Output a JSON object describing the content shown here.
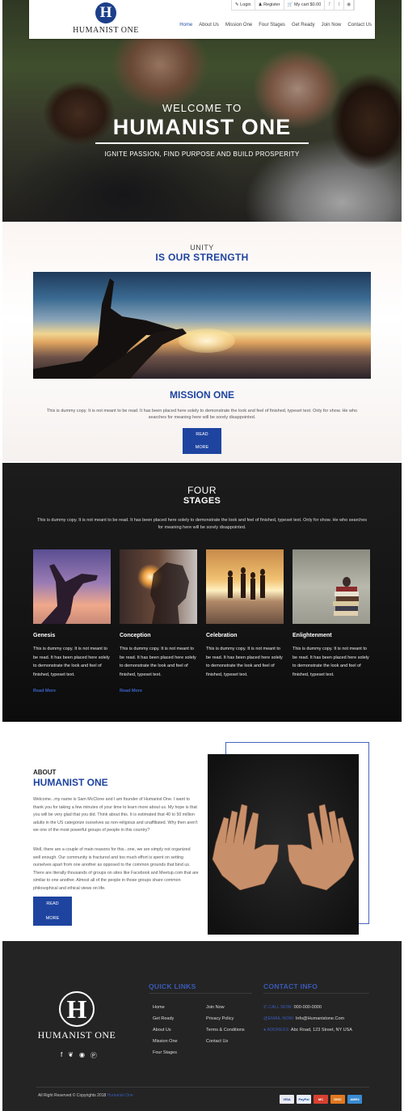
{
  "nav": {
    "logo_text": "HUMANIST ONE",
    "topbar": {
      "login": "Login",
      "register": "Register",
      "cart": "My cart $0.00"
    },
    "menu": [
      "Home",
      "About Us",
      "Mission One",
      "Four Stages",
      "Get Ready",
      "Join Now",
      "Contact Us"
    ],
    "active": "Home"
  },
  "hero": {
    "welcome": "WELCOME TO",
    "brand": "HUMANIST ONE",
    "tagline": "IGNITE PASSION, FIND PURPOSE AND BUILD PROSPERITY"
  },
  "unity": {
    "small": "UNITY",
    "big": "IS OUR STRENGTH",
    "mission_title": "MISSION ONE",
    "mission_text": "This is dummy copy. It is not meant to be read. It has been placed here solely to demonstrate the look and feel of finished, typeset text. Only for show. He who searches for meaning here will be sorely disappointed.",
    "button": "READ MORE"
  },
  "stages": {
    "small": "FOUR",
    "big": "STAGES",
    "intro": "This is dummy copy. It is not meant to be read. It has been placed here solely to demonstrate the look and feel of finished, typeset text. Only for show. He who searches for meaning here will be sorely disappointed.",
    "cards": [
      {
        "title": "Genesis",
        "text": "This is dummy copy. It is not meant to be read. It has been placed here solely to demonstrate the look and feel of finished, typeset text.",
        "more": "Read More"
      },
      {
        "title": "Conception",
        "text": "This is dummy copy. It is not meant to be read. It has been placed here solely to demonstrate the look and feel of finished, typeset text.",
        "more": "Read More"
      },
      {
        "title": "Celebration",
        "text": "This is dummy copy. It is not meant to be read. It has been placed here solely to demonstrate the look and feel of finished, typeset text.",
        "more": ""
      },
      {
        "title": "Enlightenment",
        "text": "This is dummy copy. It is not meant to be read. It has been placed here solely to demonstrate the look and feel of finished, typeset text.",
        "more": ""
      }
    ]
  },
  "about": {
    "small": "ABOUT",
    "big": "HUMANIST ONE",
    "p1": "Welcome...my name is Sam McClone and I am founder of Humanist One. I want to thank you for taking a few minutes of your time to learn more about us. My hope is that you will be very glad that you did. Think about this. It is estimated that 40 to 50 million adults in the US categorize ourselves as non-religious and unaffiliated. Why then aren't we one of the most powerful groups of people in this country?",
    "p2": "Well, there are a couple of main reasons for this...one, we are simply not organized well enough. Our community is fractured and too much effort is spent on setting ourselves apart from one another as opposed to the common grounds that bind us. There are literally thousands of groups on sites like Facebook and Meetup.com that are similar to one another. Almost all of the people in those groups share common philosophical and ethical views on life.",
    "button": "READ MORE"
  },
  "footer": {
    "logo_text": "HUMANIST ONE",
    "quick_links_title": "QUICK LINKS",
    "links_col1": [
      "Home",
      "Get Ready",
      "About Us",
      "Mission One",
      "Four Stages"
    ],
    "links_col2": [
      "Join Now",
      "Privacy Policy",
      "Terms & Conditions",
      "Contact Us"
    ],
    "contact_title": "CONTACT INFO",
    "call_label": "CALL NOW:",
    "call_value": "000-000-0000",
    "email_label": "EMAIL NOW:",
    "email_value": "Info@Humanistone.Com",
    "address_label": "ADDRESS:",
    "address_value": "Abc Road, 123 Street, NY USA",
    "copyright": "All Right Reserved © Copyrights 2018",
    "copyright_brand": "Humanist One",
    "payments": [
      "VISA",
      "PayPal",
      "MC",
      "DISC",
      "AMEX"
    ]
  },
  "colors": {
    "brand_blue": "#1e44a0",
    "footer_bg": "#242424"
  }
}
